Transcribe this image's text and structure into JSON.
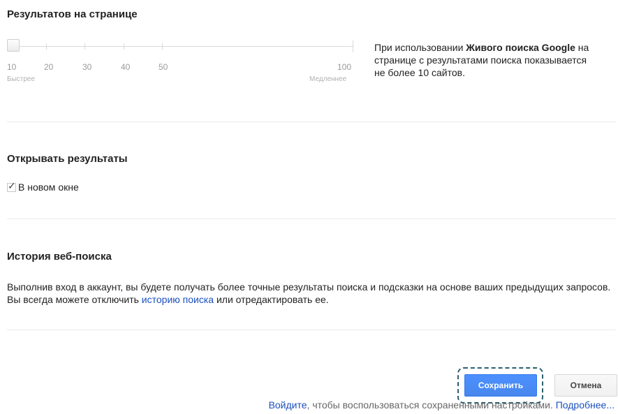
{
  "results_per_page": {
    "title": "Результатов на странице",
    "value": 10,
    "ticks": [
      "10",
      "20",
      "30",
      "40",
      "50",
      "100"
    ],
    "faster_label": "Быстрее",
    "slower_label": "Медленнее",
    "info": {
      "part1": "При использовании ",
      "bold1": "Живого поиска Google",
      "part2": " на странице с результатами поиска показывается не более 10 сайтов."
    }
  },
  "open_results": {
    "title": "Открывать результаты",
    "new_window_label": "В новом окне",
    "new_window_checked": true
  },
  "web_history": {
    "title": "История веб-поиска",
    "text_before": "Выполнив вход в аккаунт, вы будете получать более точные результаты поиска и подсказки на основе ваших предыдущих запросов. Вы всегда можете отключить ",
    "link": "историю поиска",
    "text_after": " или отредактировать ее."
  },
  "actions": {
    "save_label": "Сохранить",
    "cancel_label": "Отмена"
  },
  "footer": {
    "signin_link": "Войдите",
    "text": ", чтобы воспользоваться сохраненными настройками. ",
    "more_link": "Подробнее..."
  },
  "colors": {
    "primary_button": "#4d90fe",
    "link": "#1a4fbf",
    "focus_ring": "#2b5f6d"
  }
}
